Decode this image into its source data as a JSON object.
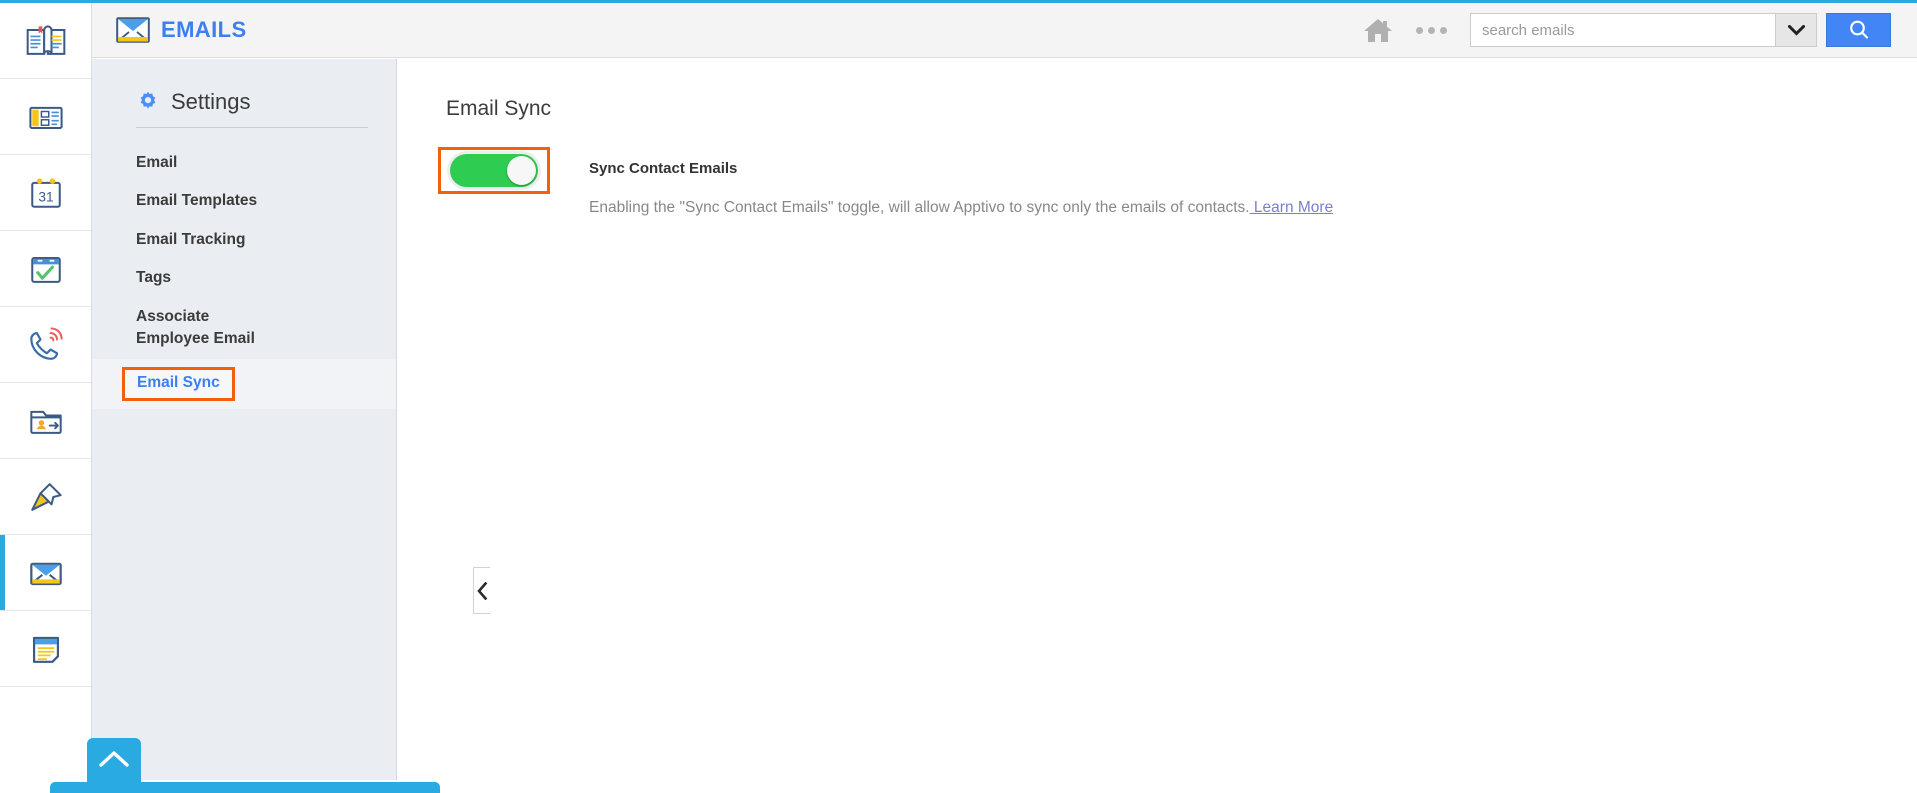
{
  "theme": {
    "accent_blue": "#29abe2",
    "link_blue": "#3d7ff0",
    "highlight_orange": "#f2600c",
    "toggle_green": "#2ecc51",
    "panel_bg": "#eaeef3",
    "header_bg": "#f4f4f4"
  },
  "rail": {
    "items": [
      {
        "name": "news-book-icon",
        "label": "Ledger"
      },
      {
        "name": "newsletter-icon",
        "label": "News"
      },
      {
        "name": "calendar-icon",
        "label": "Calendar",
        "day": "31"
      },
      {
        "name": "tasks-check-icon",
        "label": "Tasks"
      },
      {
        "name": "phone-call-icon",
        "label": "Calls"
      },
      {
        "name": "contact-folder-icon",
        "label": "Contacts"
      },
      {
        "name": "pin-icon",
        "label": "Pinned"
      },
      {
        "name": "email-envelope-icon",
        "label": "Emails",
        "active": true
      },
      {
        "name": "notes-icon",
        "label": "Notes"
      }
    ]
  },
  "header": {
    "app_icon": "email-envelope-icon",
    "title": "EMAILS",
    "home_icon": "home-icon",
    "more_icon": "ellipsis-icon",
    "search": {
      "placeholder": "search emails",
      "value": "",
      "caret_icon": "chevron-down-icon",
      "button_icon": "search-icon"
    }
  },
  "settings": {
    "gear_icon": "gear-icon",
    "title": "Settings",
    "items": [
      {
        "label": "Email",
        "selected": false
      },
      {
        "label": "Email Templates",
        "selected": false
      },
      {
        "label": "Email Tracking",
        "selected": false
      },
      {
        "label": "Tags",
        "selected": false
      },
      {
        "label": "Associate Employee Email",
        "selected": false
      },
      {
        "label": "Email Sync",
        "selected": true
      }
    ],
    "collapse_icon": "chevron-left-icon"
  },
  "main": {
    "page_title": "Email Sync",
    "toggle": {
      "state": "on",
      "label": "Sync Contact Emails",
      "description": "Enabling the \"Sync Contact Emails\" toggle, will allow Apptivo to sync only the emails of contacts.",
      "link_label": " Learn More"
    }
  },
  "footer": {
    "scroll_top_icon": "chevron-up-icon"
  }
}
